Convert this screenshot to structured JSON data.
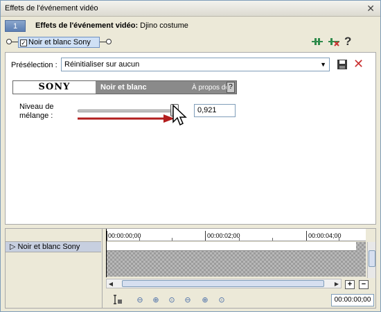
{
  "window": {
    "title": "Effets de l'événement vidéo",
    "close_glyph": "✕"
  },
  "event_row": {
    "number": "1",
    "label": "Effets de l'événement vidéo:",
    "value": "Djino costume"
  },
  "chain": {
    "plugin_name": "Noir et blanc Sony",
    "enabled": true,
    "check_glyph": "✓"
  },
  "toolbar": {
    "icons": [
      "plugin-chain-icon",
      "remove-plugin-icon",
      "help-icon"
    ],
    "help_glyph": "?"
  },
  "preset": {
    "label": "Présélection :",
    "value": "Réinitialiser sur aucun",
    "arrow": "▼",
    "delete_glyph": "✕"
  },
  "plugin_header": {
    "logo": "SONY",
    "name": "Noir et blanc",
    "about": "À propos de",
    "help_glyph": "?"
  },
  "blend": {
    "label_line1": "Niveau de",
    "label_line2": "mélange :",
    "value": "0,921",
    "level": 0.921
  },
  "timeline": {
    "track_name": "Noir et blanc Sony",
    "expander": "▷",
    "ruler_marks": [
      "00:00:00;00",
      "00:00:02;00",
      "00:00:04;00"
    ],
    "timecode": "00:00:00;00",
    "zoom_in": "+",
    "zoom_out": "−",
    "transport": [
      "◈",
      "⊖",
      "⊕",
      "⊙",
      "⊖",
      "⊕",
      "⊙"
    ]
  }
}
